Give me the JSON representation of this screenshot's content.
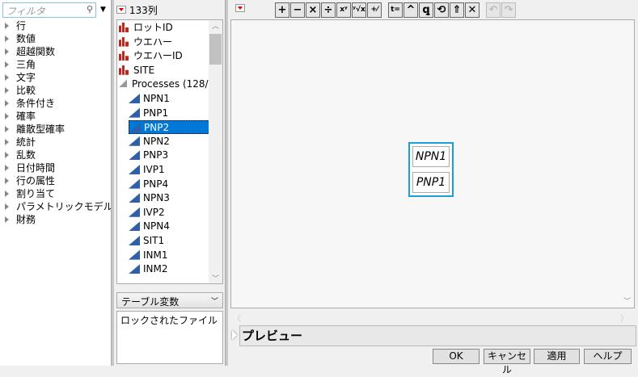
{
  "functions": {
    "filter_placeholder": "フィルタ",
    "categories": [
      "行",
      "数値",
      "超越関数",
      "三角",
      "文字",
      "比較",
      "条件付き",
      "確率",
      "離散型確率",
      "統計",
      "乱数",
      "日付時間",
      "行の属性",
      "割り当て",
      "パラメトリックモデル",
      "財務"
    ]
  },
  "columns": {
    "count_label": "133列",
    "items": [
      {
        "label": "ロットID",
        "type": "nominal"
      },
      {
        "label": "ウエハー",
        "type": "nominal"
      },
      {
        "label": "ウエハーID",
        "type": "nominal"
      },
      {
        "label": "SITE",
        "type": "nominal"
      },
      {
        "label": "Processes (128/",
        "type": "group"
      },
      {
        "label": "NPN1",
        "type": "continuous"
      },
      {
        "label": "PNP1",
        "type": "continuous"
      },
      {
        "label": "PNP2",
        "type": "continuous",
        "selected": true
      },
      {
        "label": "NPN2",
        "type": "continuous"
      },
      {
        "label": "PNP3",
        "type": "continuous"
      },
      {
        "label": "IVP1",
        "type": "continuous"
      },
      {
        "label": "PNP4",
        "type": "continuous"
      },
      {
        "label": "NPN3",
        "type": "continuous"
      },
      {
        "label": "IVP2",
        "type": "continuous"
      },
      {
        "label": "NPN4",
        "type": "continuous"
      },
      {
        "label": "SIT1",
        "type": "continuous"
      },
      {
        "label": "INM1",
        "type": "continuous"
      },
      {
        "label": "INM2",
        "type": "continuous"
      }
    ]
  },
  "table_vars": {
    "selector": "テーブル変数",
    "items": [
      "ロックされたファイル"
    ]
  },
  "toolbar": {
    "buttons": [
      {
        "name": "add",
        "glyph": "+"
      },
      {
        "name": "subtract",
        "glyph": "−"
      },
      {
        "name": "multiply",
        "glyph": "×"
      },
      {
        "name": "divide",
        "glyph": "÷"
      },
      {
        "name": "power",
        "glyph": "xʸ"
      },
      {
        "name": "root",
        "glyph": "ʸ√x"
      },
      {
        "name": "negate",
        "glyph": "+⁄−"
      },
      {
        "name": "assign",
        "glyph": "t="
      },
      {
        "name": "peel",
        "glyph": "^"
      },
      {
        "name": "local",
        "glyph": "ꝗ"
      },
      {
        "name": "swap",
        "glyph": "⟲"
      },
      {
        "name": "unary",
        "glyph": "⇑"
      },
      {
        "name": "delete",
        "glyph": "✕"
      },
      {
        "name": "undo",
        "glyph": "↶",
        "disabled": true
      },
      {
        "name": "redo",
        "glyph": "↷",
        "disabled": true
      }
    ]
  },
  "formula": {
    "terms": [
      "NPN1",
      "PNP1"
    ]
  },
  "preview_label": "プレビュー",
  "buttons": {
    "ok": "OK",
    "cancel": "キャンセル",
    "apply": "適用",
    "help": "ヘルプ"
  }
}
